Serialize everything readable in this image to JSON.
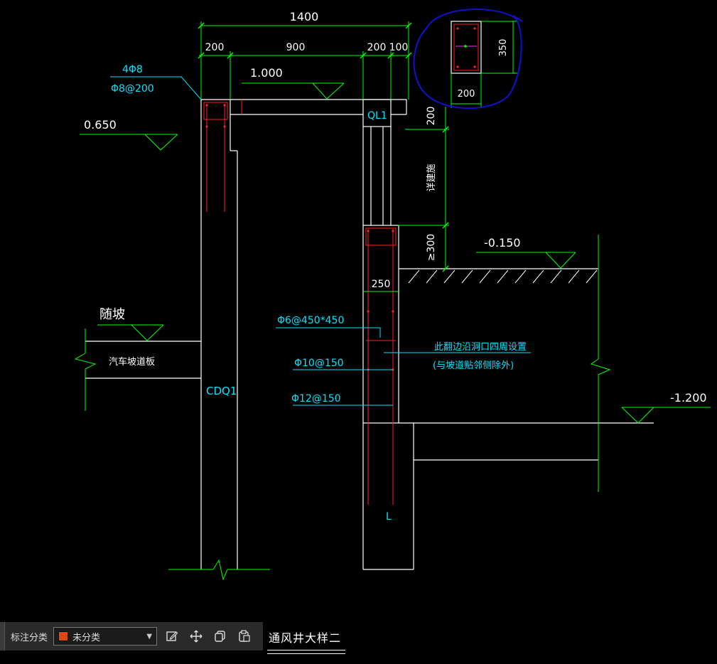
{
  "drawing": {
    "dims": {
      "overall": "1400",
      "seg_200_left": "200",
      "seg_900": "900",
      "seg_200_right": "200",
      "seg_100": "100",
      "height_200": "200",
      "height_variable": "详建施",
      "height_300": "≥300",
      "width_250": "250",
      "section_height": "350",
      "section_width": "200"
    },
    "elevations": {
      "top": "1.000",
      "mid": "0.650",
      "ground": "-0.150",
      "bottom": "-1.200"
    },
    "labels": {
      "rebar_top1": "4Φ8",
      "rebar_top2": "Φ8@200",
      "beam": "QL1",
      "wall": "CDQ1",
      "slope": "随坡",
      "ramp_slab": "汽车坡道板",
      "rebar_tie": "Φ6@450*450",
      "rebar_h": "Φ10@150",
      "rebar_v": "Φ12@150",
      "note1": "此翻边沿洞口四周设置",
      "note2": "(与坡道贴邻侧除外)",
      "bar_end": "L"
    }
  },
  "toolbar": {
    "label": "标注分类",
    "select_value": "未分类",
    "swatch_color": "#d94a14",
    "icons": [
      "edit-icon",
      "move-icon",
      "copy-icon",
      "paste-icon"
    ]
  },
  "title": "通风井大样二",
  "colors": {
    "outline": "#ffffff",
    "dimension": "#00ff00",
    "annotation": "#00e5ff",
    "rebar": "#ff2020",
    "highlight": "#1010d0"
  }
}
